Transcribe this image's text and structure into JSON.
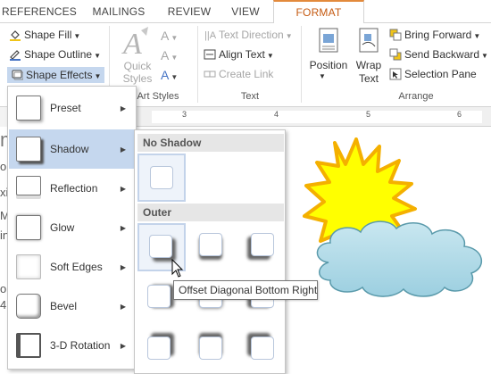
{
  "tabs": [
    {
      "label": "REFERENCES"
    },
    {
      "label": "MAILINGS"
    },
    {
      "label": "REVIEW"
    },
    {
      "label": "VIEW"
    },
    {
      "label": "FORMAT",
      "active": true
    }
  ],
  "ribbon": {
    "shape_fill": "Shape Fill",
    "shape_outline": "Shape Outline",
    "shape_effects": "Shape Effects",
    "quick_styles": "Quick Styles",
    "wordart_styles_label": "Art Styles",
    "text_direction": "Text Direction",
    "align_text": "Align Text",
    "create_link": "Create Link",
    "text_group_label": "Text",
    "position": "Position",
    "wrap_text": "Wrap Text",
    "bring_forward": "Bring Forward",
    "send_backward": "Send Backward",
    "selection_pane": "Selection Pane",
    "arrange_group_label": "Arrange"
  },
  "ruler": {
    "ticks": [
      "3",
      "4",
      "5",
      "6"
    ]
  },
  "page_fragments": [
    "m",
    "o",
    "xi",
    "M",
    "in",
    "or",
    "4"
  ],
  "effects_menu": {
    "items": [
      {
        "label": "Preset",
        "icon": "preset-icon"
      },
      {
        "label": "Shadow",
        "icon": "shadow-icon",
        "active": true
      },
      {
        "label": "Reflection",
        "icon": "reflection-icon"
      },
      {
        "label": "Glow",
        "icon": "glow-icon"
      },
      {
        "label": "Soft Edges",
        "icon": "soft-edges-icon"
      },
      {
        "label": "Bevel",
        "icon": "bevel-icon"
      },
      {
        "label": "3-D Rotation",
        "icon": "rotation-3d-icon"
      }
    ]
  },
  "shadow_gallery": {
    "no_shadow_header": "No Shadow",
    "outer_header": "Outer",
    "tooltip": "Offset Diagonal Bottom Right"
  },
  "colors": {
    "accent": "#c55a11",
    "hover": "#c5d7ee",
    "sun_fill": "#ffff00",
    "sun_stroke": "#f4b000",
    "cloud_fill": "#aad6e3",
    "cloud_stroke": "#5a9aab"
  }
}
